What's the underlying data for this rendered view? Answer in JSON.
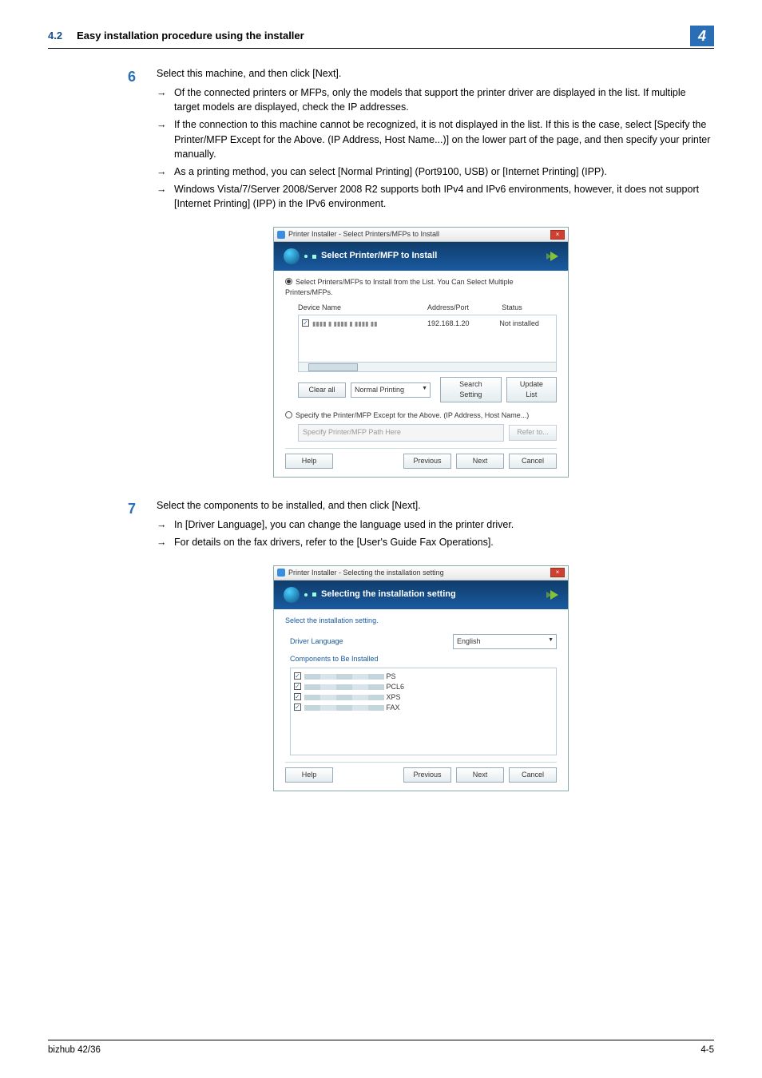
{
  "header": {
    "section_number": "4.2",
    "section_title": "Easy installation procedure using the installer",
    "chapter_number": "4"
  },
  "steps": {
    "s6": {
      "num": "6",
      "text": "Select this machine, and then click [Next].",
      "bullets": [
        "Of the connected printers or MFPs, only the models that support the printer driver are displayed in the list. If multiple target models are displayed, check the IP addresses.",
        "If the connection to this machine cannot be recognized, it is not displayed in the list. If this is the case, select [Specify the Printer/MFP Except for the Above. (IP Address, Host Name...)] on the lower part of the page, and then specify your printer manually.",
        "As a printing method, you can select [Normal Printing] (Port9100, USB) or [Internet Printing] (IPP).",
        "Windows Vista/7/Server 2008/Server 2008 R2 supports both IPv4 and IPv6 environments, however, it does not support [Internet Printing] (IPP) in the IPv6 environment."
      ]
    },
    "s7": {
      "num": "7",
      "text": "Select the components to be installed, and then click [Next].",
      "bullets": [
        "In [Driver Language], you can change the language used in the printer driver.",
        "For details on the fax drivers, refer to the [User's Guide Fax Operations]."
      ]
    }
  },
  "dialog1": {
    "title": "Printer Installer - Select Printers/MFPs to Install",
    "banner": "Select Printer/MFP to Install",
    "radio1": "Select Printers/MFPs to Install from the List. You Can Select Multiple Printers/MFPs.",
    "col_device": "Device Name",
    "col_addr": "Address/Port",
    "col_status": "Status",
    "row_addr": "192.168.1.20",
    "row_status": "Not installed",
    "clear_all": "Clear all",
    "normal_printing": "Normal Printing",
    "search_setting": "Search Setting",
    "update_list": "Update List",
    "radio2": "Specify the Printer/MFP Except for the Above. (IP Address, Host Name...)",
    "path_placeholder": "Specify Printer/MFP Path Here",
    "refer_to": "Refer to...",
    "help": "Help",
    "previous": "Previous",
    "next": "Next",
    "cancel": "Cancel"
  },
  "dialog2": {
    "title": "Printer Installer - Selecting the installation setting",
    "banner": "Selecting the installation setting",
    "instruction": "Select the installation setting.",
    "driver_language_label": "Driver Language",
    "driver_language_value": "English",
    "components_label": "Components to Be Installed",
    "components": [
      "PS",
      "PCL6",
      "XPS",
      "FAX"
    ],
    "help": "Help",
    "previous": "Previous",
    "next": "Next",
    "cancel": "Cancel"
  },
  "footer": {
    "model": "bizhub 42/36",
    "page": "4-5"
  },
  "glyphs": {
    "arrow": "→"
  }
}
